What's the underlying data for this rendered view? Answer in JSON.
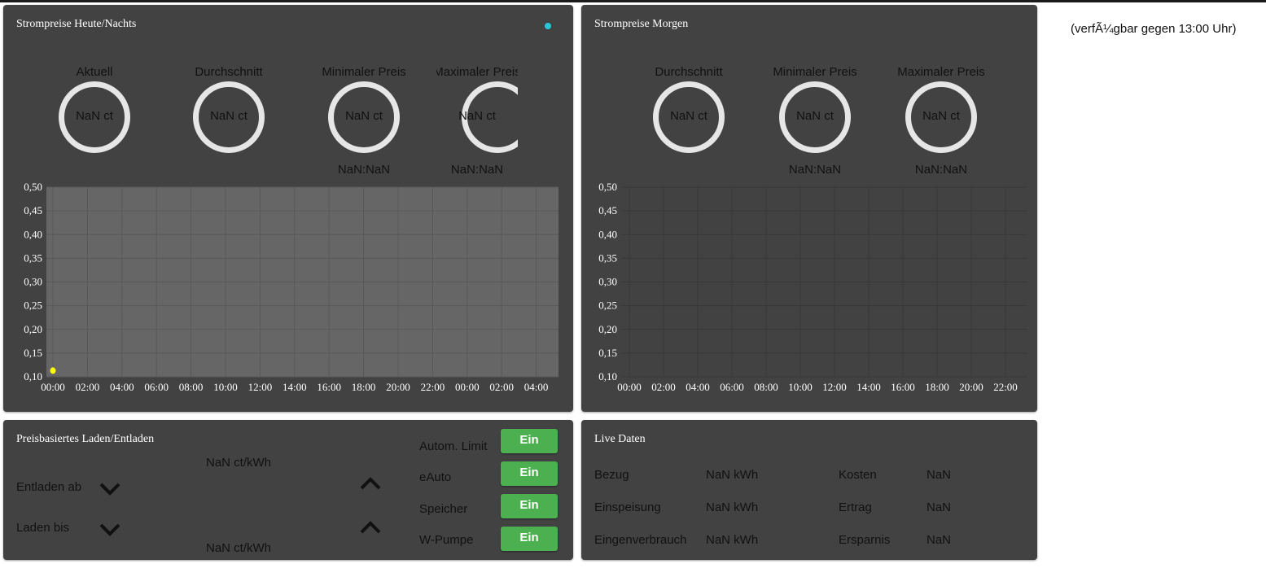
{
  "note": "(verfÃ¼gbar gegen 13:00 Uhr)",
  "today": {
    "title": "Strompreise Heute/Nachts",
    "status_dot_color": "#26c6da",
    "gauges": [
      {
        "label": "Aktuell",
        "value": "NaN ct",
        "time": ""
      },
      {
        "label": "Durchschnitt",
        "value": "NaN ct",
        "time": ""
      },
      {
        "label": "Minimaler Preis",
        "value": "NaN ct",
        "time": "NaN:NaN"
      },
      {
        "label": "Maximaler Preis",
        "value": "NaN ct",
        "time": "NaN:NaN"
      }
    ]
  },
  "tomorrow": {
    "title": "Strompreise Morgen",
    "gauges": [
      {
        "label": "Durchschnitt",
        "value": "NaN ct",
        "time": ""
      },
      {
        "label": "Minimaler Preis",
        "value": "NaN ct",
        "time": "NaN:NaN"
      },
      {
        "label": "Maximaler Preis",
        "value": "NaN ct",
        "time": "NaN:NaN"
      }
    ]
  },
  "chart_data": [
    {
      "type": "scatter",
      "title": "Strompreise Heute/Nachts",
      "ylim": [
        0.1,
        0.5
      ],
      "yticks": [
        "0,50",
        "0,45",
        "0,40",
        "0,35",
        "0,30",
        "0,25",
        "0,20",
        "0,15",
        "0,10"
      ],
      "xticks": [
        "00:00",
        "02:00",
        "04:00",
        "06:00",
        "08:00",
        "10:00",
        "12:00",
        "14:00",
        "16:00",
        "18:00",
        "20:00",
        "22:00",
        "00:00",
        "02:00",
        "04:00"
      ],
      "points": [
        {
          "x": 0,
          "y": 0.113,
          "color": "#ffff00"
        }
      ],
      "grid": true
    },
    {
      "type": "line",
      "title": "Strompreise Morgen",
      "ylim": [
        0.1,
        0.5
      ],
      "yticks": [
        "0,50",
        "0,45",
        "0,40",
        "0,35",
        "0,30",
        "0,25",
        "0,20",
        "0,15",
        "0,10"
      ],
      "xticks": [
        "00:00",
        "02:00",
        "04:00",
        "06:00",
        "08:00",
        "10:00",
        "12:00",
        "14:00",
        "16:00",
        "18:00",
        "20:00",
        "22:00"
      ],
      "points": [],
      "grid": true
    }
  ],
  "charging": {
    "title": "Preisbasiertes Laden/Entladen",
    "discharge_label": "Entladen ab",
    "discharge_value": "NaN ct/kWh",
    "charge_label": "Laden bis",
    "charge_value": "NaN ct/kWh",
    "toggles": [
      {
        "label": "Autom. Limit",
        "button": "Ein"
      },
      {
        "label": "eAuto",
        "button": "Ein"
      },
      {
        "label": "Speicher",
        "button": "Ein"
      },
      {
        "label": "W-Pumpe",
        "button": "Ein"
      }
    ],
    "button_color": "#4caf50"
  },
  "live": {
    "title": "Live Daten",
    "rows": [
      {
        "label": "Bezug",
        "value": "NaN kWh",
        "label2": "Kosten",
        "value2": "NaN"
      },
      {
        "label": "Einspeisung",
        "value": "NaN kWh",
        "label2": "Ertrag",
        "value2": "NaN"
      },
      {
        "label": "Eingenverbrauch",
        "value": "NaN kWh",
        "label2": "Ersparnis",
        "value2": "NaN"
      }
    ]
  }
}
